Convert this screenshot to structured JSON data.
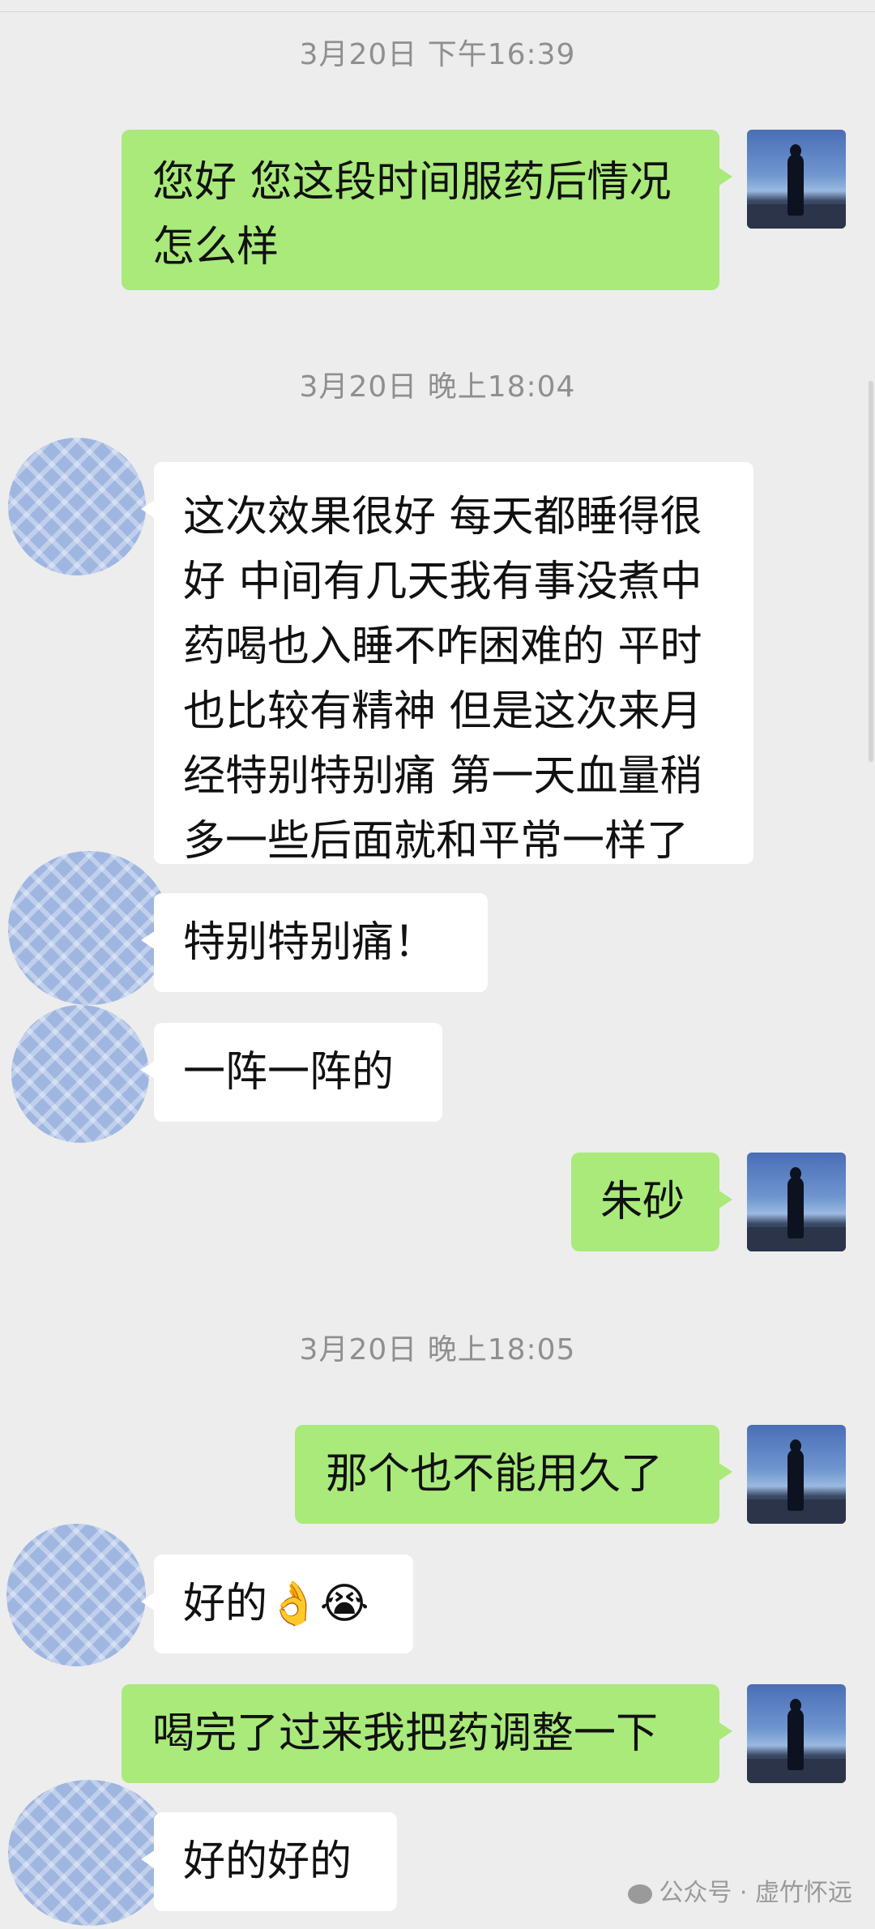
{
  "timestamps": [
    "3月20日 下午16:39",
    "3月20日 晚上18:04",
    "3月20日 晚上18:05"
  ],
  "messages": {
    "m1": "您好 您这段时间服药后情况怎么样",
    "m2": "这次效果很好 每天都睡得很好 中间有几天我有事没煮中药喝也入睡不咋困难的 平时也比较有精神 但是这次来月经特别特别痛 第一天血量稍多一些后面就和平常一样了",
    "m3": "特别特别痛！",
    "m4": "一阵一阵的",
    "m5": "朱砂",
    "m6": "那个也不能用久了",
    "m7": "好的👌😭",
    "m8": "喝完了过来我把药调整一下",
    "m9": "好的好的"
  },
  "watermark": "公众号 · 虚竹怀远",
  "colors": {
    "me_bubble": "#a9ea7a",
    "other_bubble": "#ffffff",
    "background": "#ededed"
  }
}
